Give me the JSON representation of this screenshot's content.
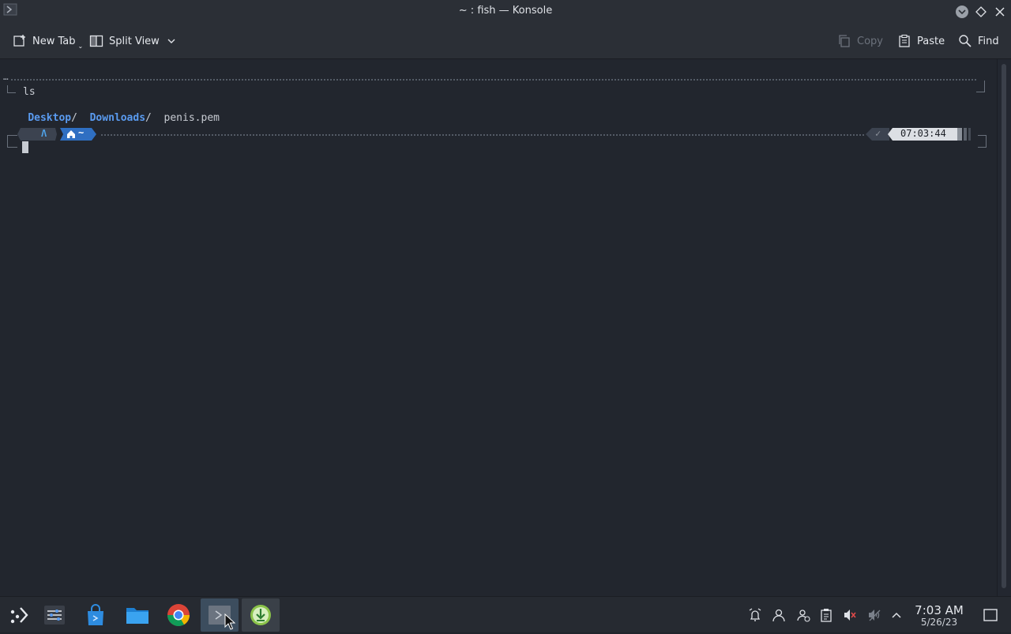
{
  "window": {
    "title": "~ : fish — Konsole"
  },
  "toolbar": {
    "new_tab_label": "New Tab",
    "split_view_label": "Split View",
    "copy_label": "Copy",
    "paste_label": "Paste",
    "find_label": "Find"
  },
  "terminal": {
    "prev_prompt_ellipsis": "…",
    "command": "ls",
    "output": [
      {
        "name": "Desktop",
        "suffix": "/",
        "is_dir": true
      },
      {
        "name": "Downloads",
        "suffix": "/",
        "is_dir": true
      },
      {
        "name": "penis.pem",
        "suffix": "",
        "is_dir": false
      }
    ],
    "prompt": {
      "os_glyph": "Λ",
      "path": "~",
      "status": "✓",
      "time": "07:03:44"
    }
  },
  "taskbar": {
    "clock_time": "7:03 AM",
    "clock_date": "5/26/23",
    "apps": [
      "application-launcher",
      "system-settings",
      "discover-store",
      "file-manager",
      "chrome",
      "konsole",
      "downloader"
    ],
    "active_app": "konsole"
  },
  "colors": {
    "accent": "#5a9bf0",
    "background": "#22262e",
    "panel": "#2b2f36"
  }
}
